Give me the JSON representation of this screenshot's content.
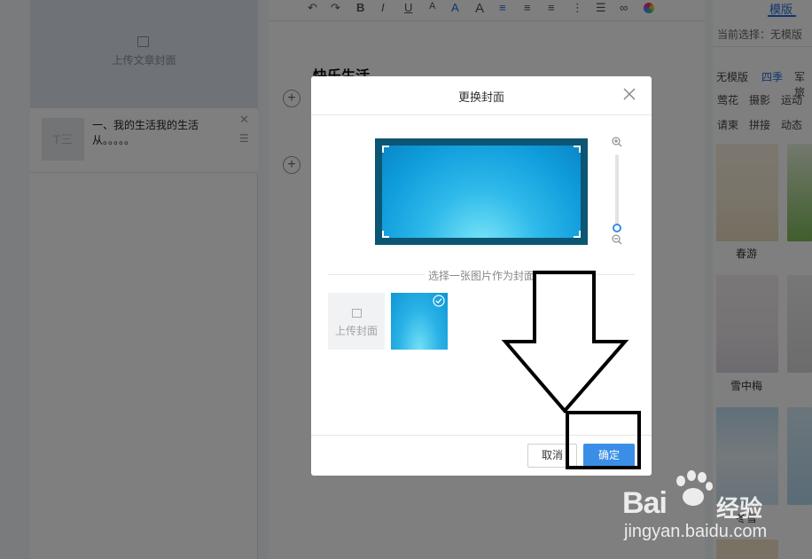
{
  "left_panel": {
    "upload_cover_label": "上传文章封面",
    "article_thumb_text": "T三",
    "article_title": "一、我的生活我的生活从。。。。。"
  },
  "editor": {
    "title": "快乐生活"
  },
  "right_panel": {
    "tab": "模版",
    "current_selection": "当前选择：无模版",
    "categories": [
      "无模版",
      "四季",
      "军旅",
      "莺花",
      "摄影",
      "运动",
      "请柬",
      "拼接",
      "动态"
    ],
    "templates": [
      "春游",
      "雪中梅",
      "冬雪"
    ]
  },
  "dialog": {
    "title": "更换封面",
    "choose_text": "选择一张图片作为封面",
    "upload_cover_label": "上传封面",
    "cancel_label": "取消",
    "confirm_label": "确定",
    "accent_color": "#3a8ee6"
  },
  "watermark": {
    "brand": "Bai",
    "brand2": "经验",
    "url": "jingyan.baidu.com"
  }
}
